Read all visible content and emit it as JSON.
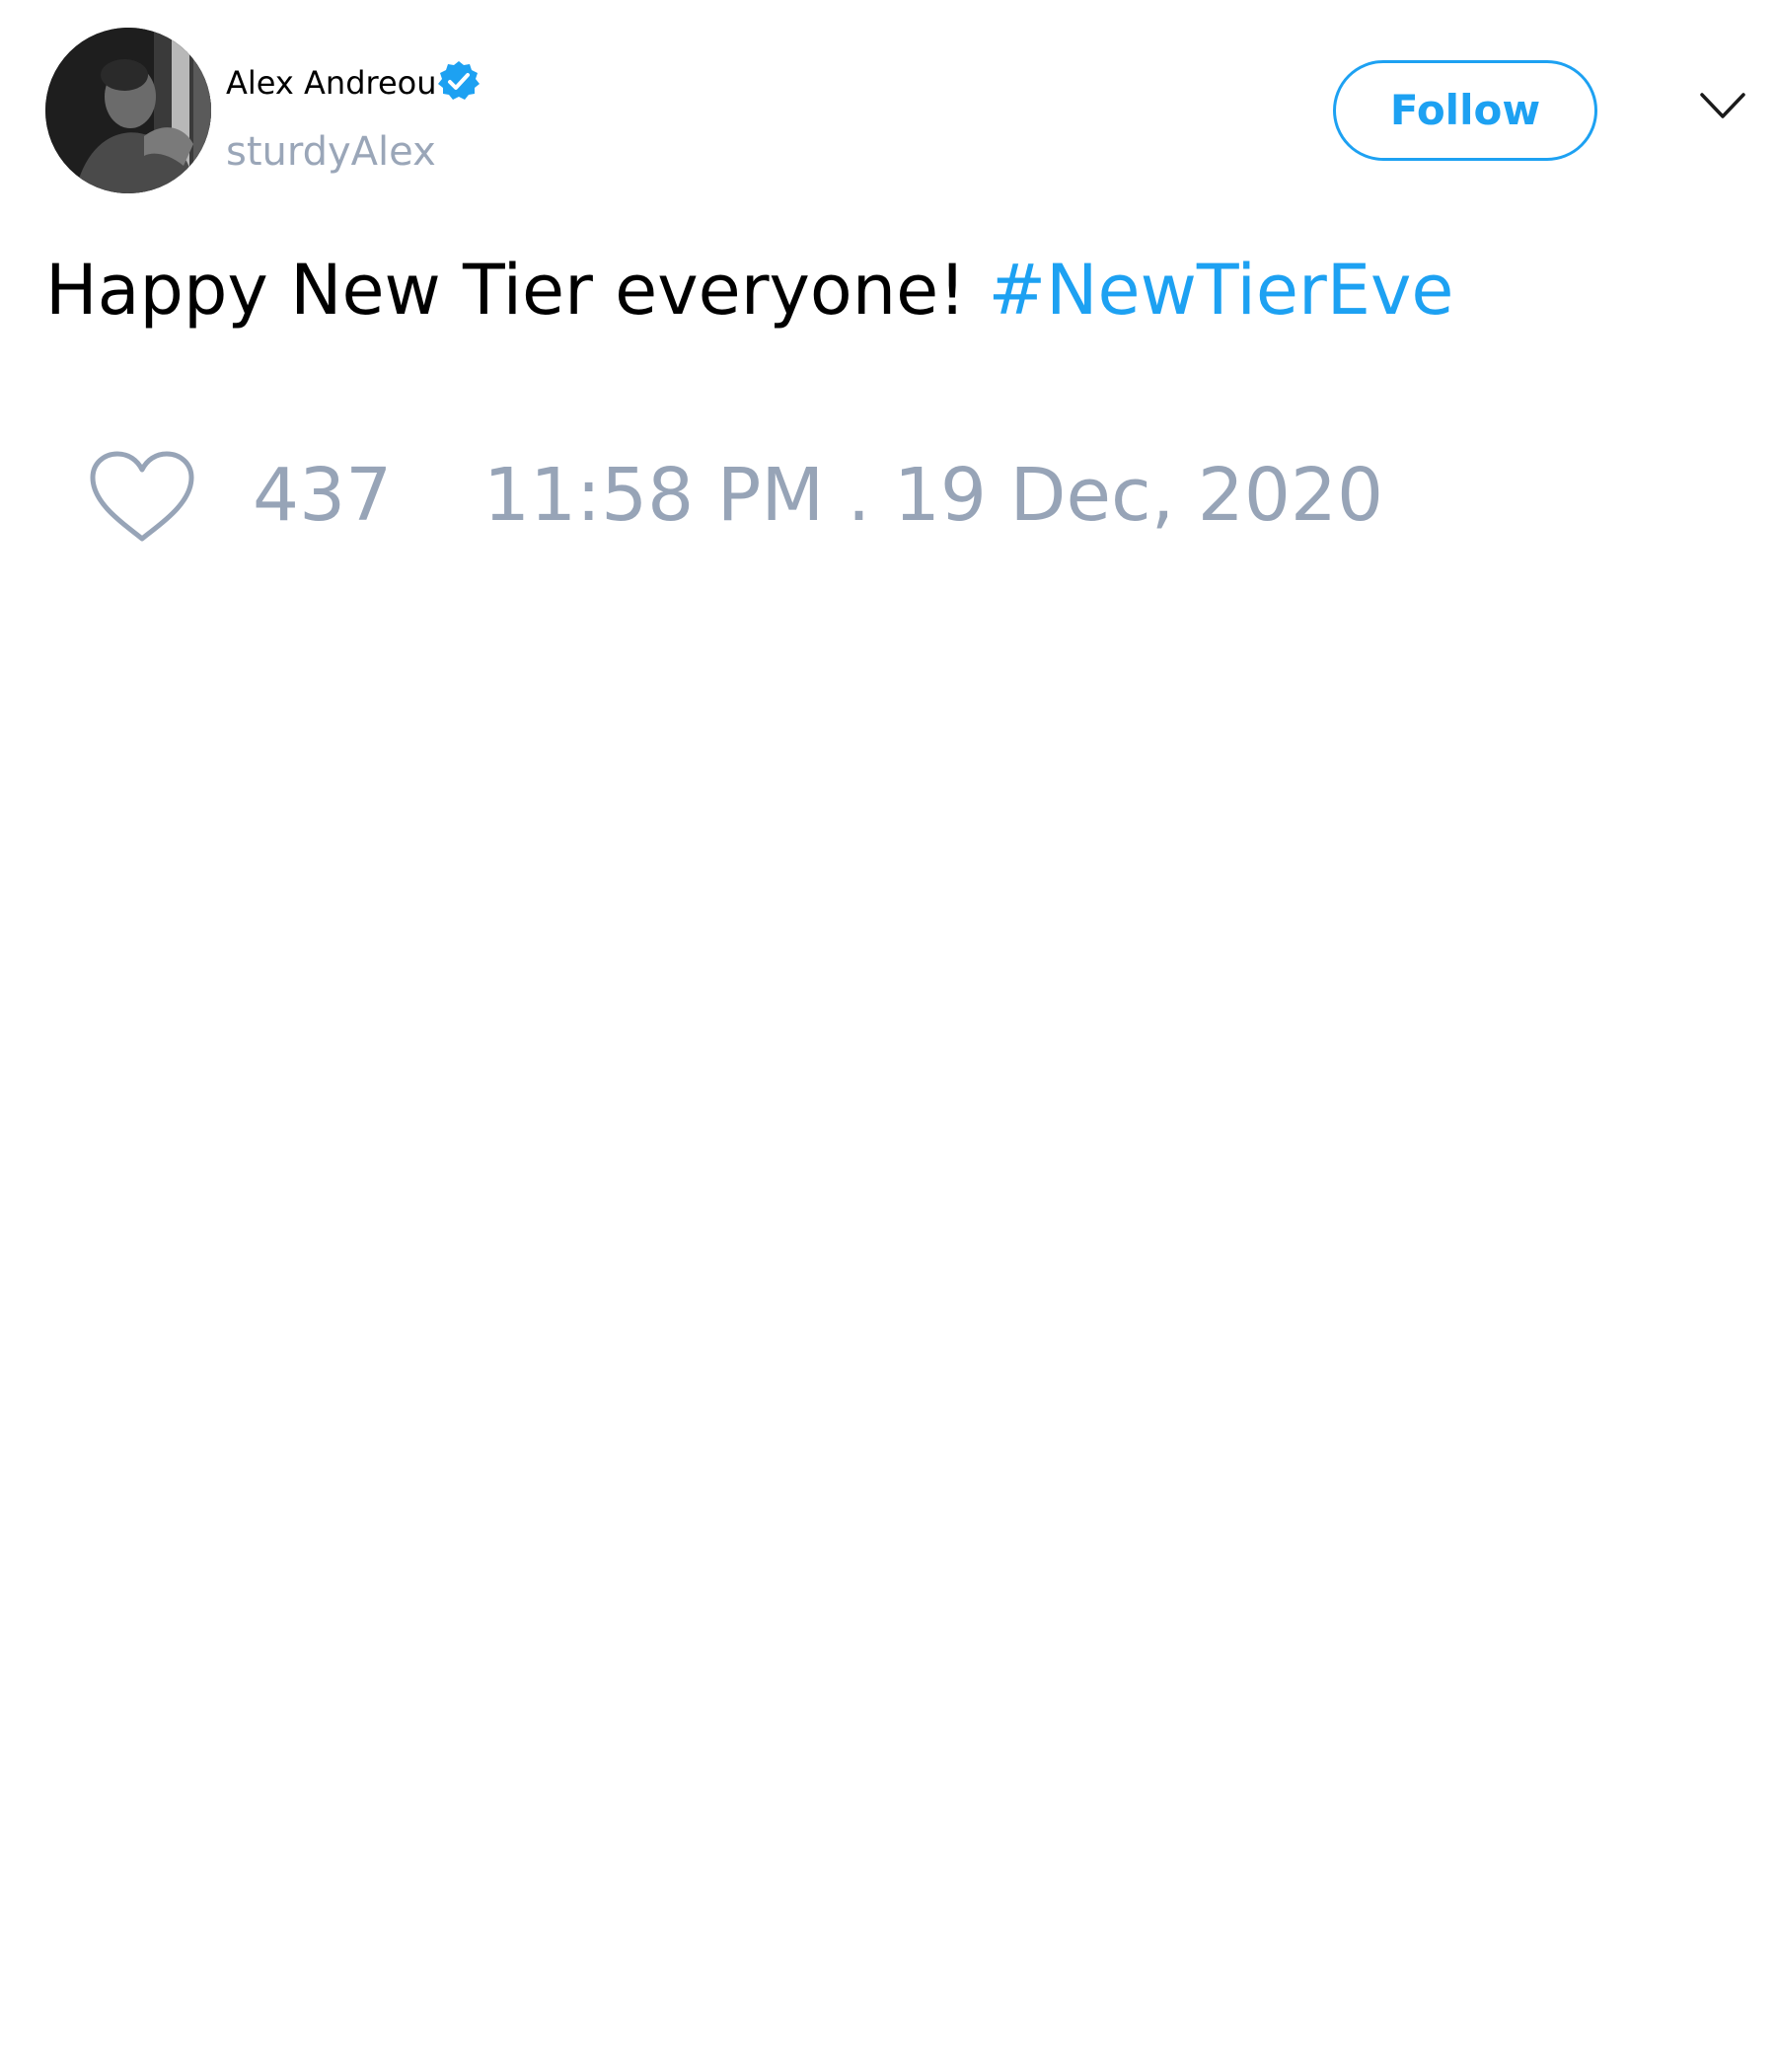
{
  "user": {
    "display_name": "Alex Andreou",
    "handle": "sturdyAlex",
    "verified": true
  },
  "follow_button_label": "Follow",
  "tweet": {
    "text": "Happy New Tier everyone!",
    "hashtag": "#NewTierEve"
  },
  "likes": "437",
  "timestamp": "11:58 PM . 19 Dec, 2020",
  "colors": {
    "accent": "#1da1f2",
    "muted": "#97a4b7",
    "text": "#000000"
  },
  "icons": [
    "avatar",
    "verified-badge-icon",
    "chevron-down-icon",
    "heart-icon"
  ]
}
